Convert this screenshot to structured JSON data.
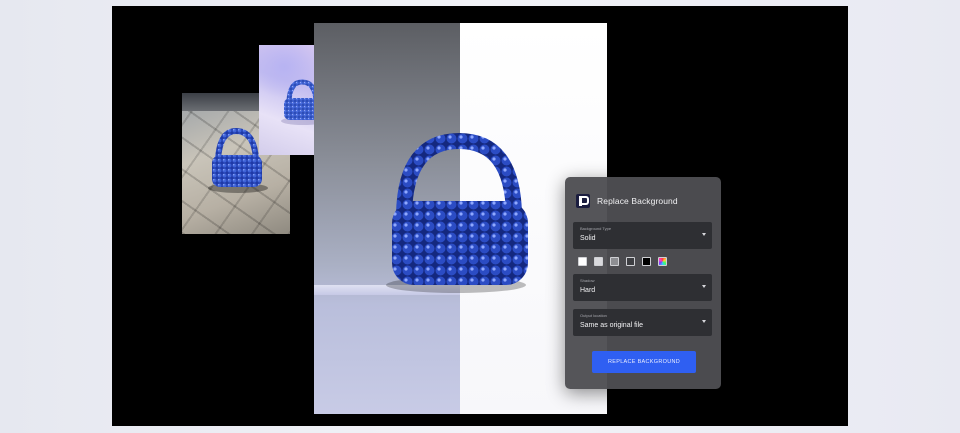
{
  "panel": {
    "title": "Replace Background",
    "logo_icon": "app-logo-icon",
    "fields": [
      {
        "label": "Background Type",
        "value": "Solid"
      },
      {
        "label": "Shadow",
        "value": "Hard"
      },
      {
        "label": "Output location",
        "value": "Same as original file"
      }
    ],
    "swatches": [
      {
        "name": "white",
        "color": "#ffffff"
      },
      {
        "name": "light-gray",
        "color": "#d9d9dd"
      },
      {
        "name": "gray",
        "color": "#8d8e92"
      },
      {
        "name": "dark-gray",
        "color": "#3d3e42"
      },
      {
        "name": "black",
        "color": "#000000"
      },
      {
        "name": "multicolor",
        "color": "conic"
      }
    ],
    "button_label": "REPLACE BACKGROUND",
    "accent_color": "#2f5ff2"
  },
  "photos": [
    {
      "name": "street-photo"
    },
    {
      "name": "pastel-photo"
    },
    {
      "name": "main-photo"
    }
  ]
}
